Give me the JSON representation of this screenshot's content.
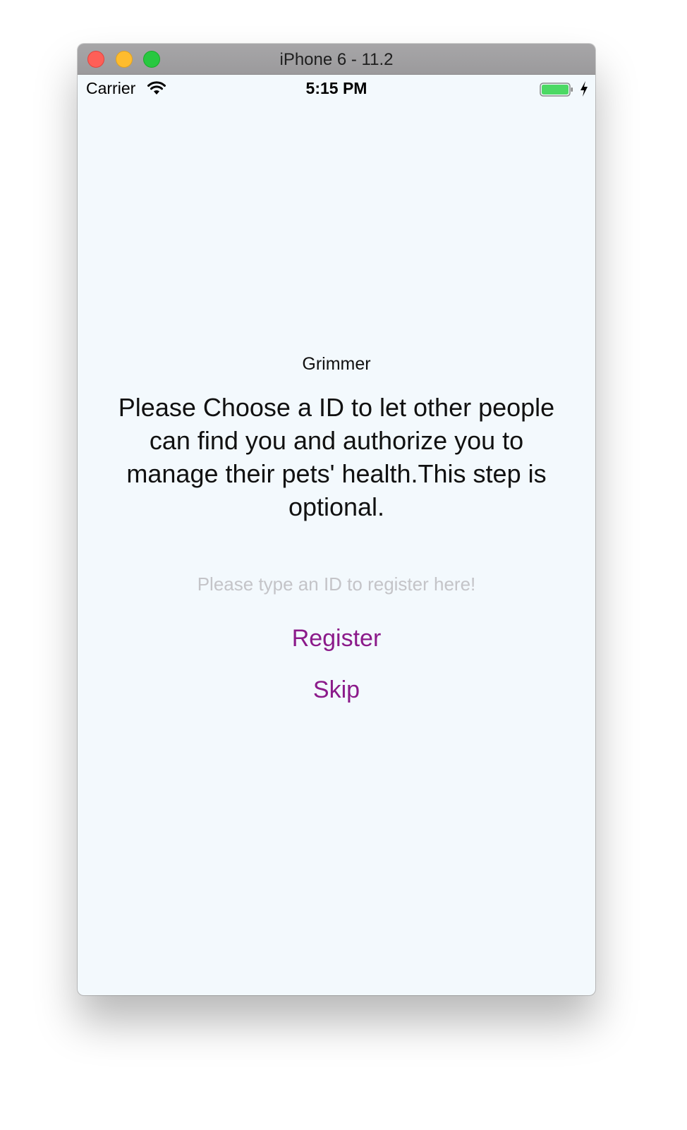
{
  "window": {
    "title": "iPhone 6 - 11.2"
  },
  "statusbar": {
    "carrier": "Carrier",
    "time": "5:15 PM",
    "wifi_icon": "wifi-icon",
    "battery_icon": "battery-icon",
    "charging_icon": "charging-bolt-icon"
  },
  "main": {
    "app_name": "Grimmer",
    "instructions": "Please Choose a ID to let other people can find you and authorize you to manage their pets' health.This step is optional.",
    "id_input": {
      "value": "",
      "placeholder": "Please type an ID to register here!"
    },
    "register_label": "Register",
    "skip_label": "Skip"
  },
  "colors": {
    "accent": "#8b1a8a",
    "background": "#f3f9fd",
    "placeholder": "#c4c4c8",
    "battery": "#4cd964"
  }
}
